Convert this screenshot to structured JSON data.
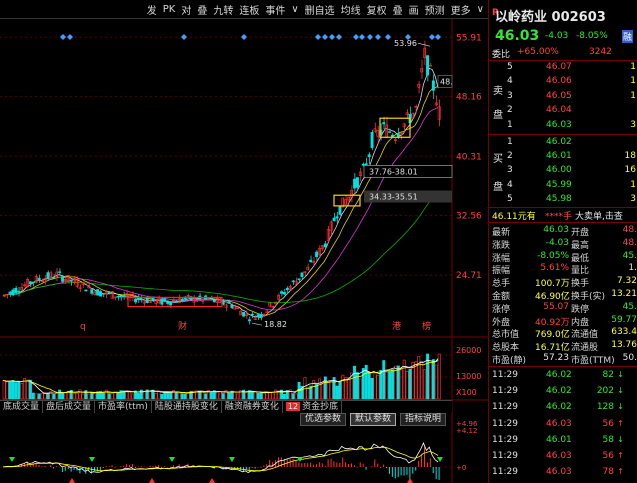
{
  "toolbar": {
    "items": [
      "发",
      "PK",
      "对",
      "叠",
      "九转",
      "连板",
      "事件",
      "∨",
      "删自选",
      "均线",
      "复权",
      "叠",
      "画",
      "预测",
      "更多",
      "∨"
    ]
  },
  "chart": {
    "price_axis": [
      "55.91",
      "48.16",
      "40.31",
      "32.56",
      "24.71"
    ],
    "volume_axis": [
      "26000",
      "13000",
      "X100"
    ],
    "macd_axis": [
      "+4.96",
      "+4.12",
      "+0"
    ],
    "high_label": "53.96",
    "low_label": "18.82",
    "right_edge_label": "48.",
    "range_label_1": "37.76-38.01",
    "range_label_2": "34.33-35.51",
    "event_marks": [
      "q",
      "财",
      "港",
      "榜"
    ],
    "colors": {
      "up": "#ff3232",
      "down": "#00e0e0",
      "ma_yellow": "#ffff00",
      "ma_white": "#ffffff",
      "ma_magenta": "#ff40ff",
      "ma_green": "#00d000",
      "box": "#ff2020",
      "box_yellow": "#ffd400"
    }
  },
  "indicator_tabs": [
    "底成交量",
    "盘后成交量",
    "市盈率(ttm)",
    "陆股通持股变化",
    "融资融券变化"
  ],
  "indicator_badge": "12",
  "indicator_tab_last": "资金抄底",
  "indicator_buttons": [
    "优选参数",
    "默认参数",
    "指标说明"
  ],
  "quote": {
    "r_label": "R",
    "name": "以岭药业",
    "code": "002603",
    "price": "46.03",
    "change": "-4.03",
    "change_pct": "-8.05%",
    "tag": "融",
    "weibi_label": "委比",
    "weibi": "+65.00%",
    "weicha": "3242",
    "sell_label": [
      "卖",
      "盘"
    ],
    "buy_label": [
      "买",
      "盘"
    ],
    "asks": [
      {
        "lvl": "5",
        "price": "46.07",
        "vol": "1"
      },
      {
        "lvl": "4",
        "price": "46.06",
        "vol": "1"
      },
      {
        "lvl": "3",
        "price": "46.05",
        "vol": "1"
      },
      {
        "lvl": "2",
        "price": "46.04",
        "vol": ""
      },
      {
        "lvl": "1",
        "price": "46.03",
        "vol": "3"
      }
    ],
    "bids": [
      {
        "lvl": "1",
        "price": "46.02",
        "vol": ""
      },
      {
        "lvl": "2",
        "price": "46.01",
        "vol": "18"
      },
      {
        "lvl": "3",
        "price": "46.00",
        "vol": "16"
      },
      {
        "lvl": "4",
        "price": "45.99",
        "vol": "1"
      },
      {
        "lvl": "5",
        "price": "45.98",
        "vol": "3"
      }
    ],
    "banner": {
      "price": "46.11元有",
      "mid": "****手",
      "tail": "大卖单,击查"
    },
    "stats": [
      {
        "k1": "最新",
        "v1": "46.03",
        "k2": "开盘",
        "v2": "48."
      },
      {
        "k1": "涨跌",
        "v1": "-4.03",
        "k2": "最高",
        "v2": "48."
      },
      {
        "k1": "涨幅",
        "v1": "-8.05%",
        "k2": "最低",
        "v2": "45."
      },
      {
        "k1": "振幅",
        "v1": "5.61%",
        "k2": "量比",
        "v2": "1."
      },
      {
        "k1": "总手",
        "v1": "100.7万",
        "k2": "换手",
        "v2": "7.32"
      },
      {
        "k1": "金额",
        "v1": "46.90亿",
        "k2": "换手(实)",
        "v2": "13.21"
      },
      {
        "k1": "涨停",
        "v1": "55.07",
        "k2": "跌停",
        "v2": "45."
      },
      {
        "k1": "外盘",
        "v1": "40.92万",
        "k2": "内盘",
        "v2": "59.77"
      },
      {
        "k1": "总市值",
        "v1": "769.0亿",
        "k2": "流通值",
        "v2": "633.4"
      },
      {
        "k1": "总股本",
        "v1": "16.71亿",
        "k2": "流通股",
        "v2": "13.76"
      },
      {
        "k1": "市盈(静)",
        "v1": "57.23",
        "k2": "市盈(TTM)",
        "v2": "50."
      }
    ],
    "ticks": [
      {
        "time": "11:29",
        "price": "46.02",
        "vol": "82",
        "dir": "down"
      },
      {
        "time": "11:29",
        "price": "46.02",
        "vol": "202",
        "dir": "down"
      },
      {
        "time": "11:29",
        "price": "46.02",
        "vol": "128",
        "dir": "down"
      },
      {
        "time": "11:29",
        "price": "46.03",
        "vol": "56",
        "dir": "up"
      },
      {
        "time": "11:29",
        "price": "46.01",
        "vol": "58",
        "dir": "down"
      },
      {
        "time": "11:29",
        "price": "46.03",
        "vol": "56",
        "dir": "up"
      },
      {
        "time": "11:29",
        "price": "46.03",
        "vol": "78",
        "dir": "up"
      }
    ]
  }
}
